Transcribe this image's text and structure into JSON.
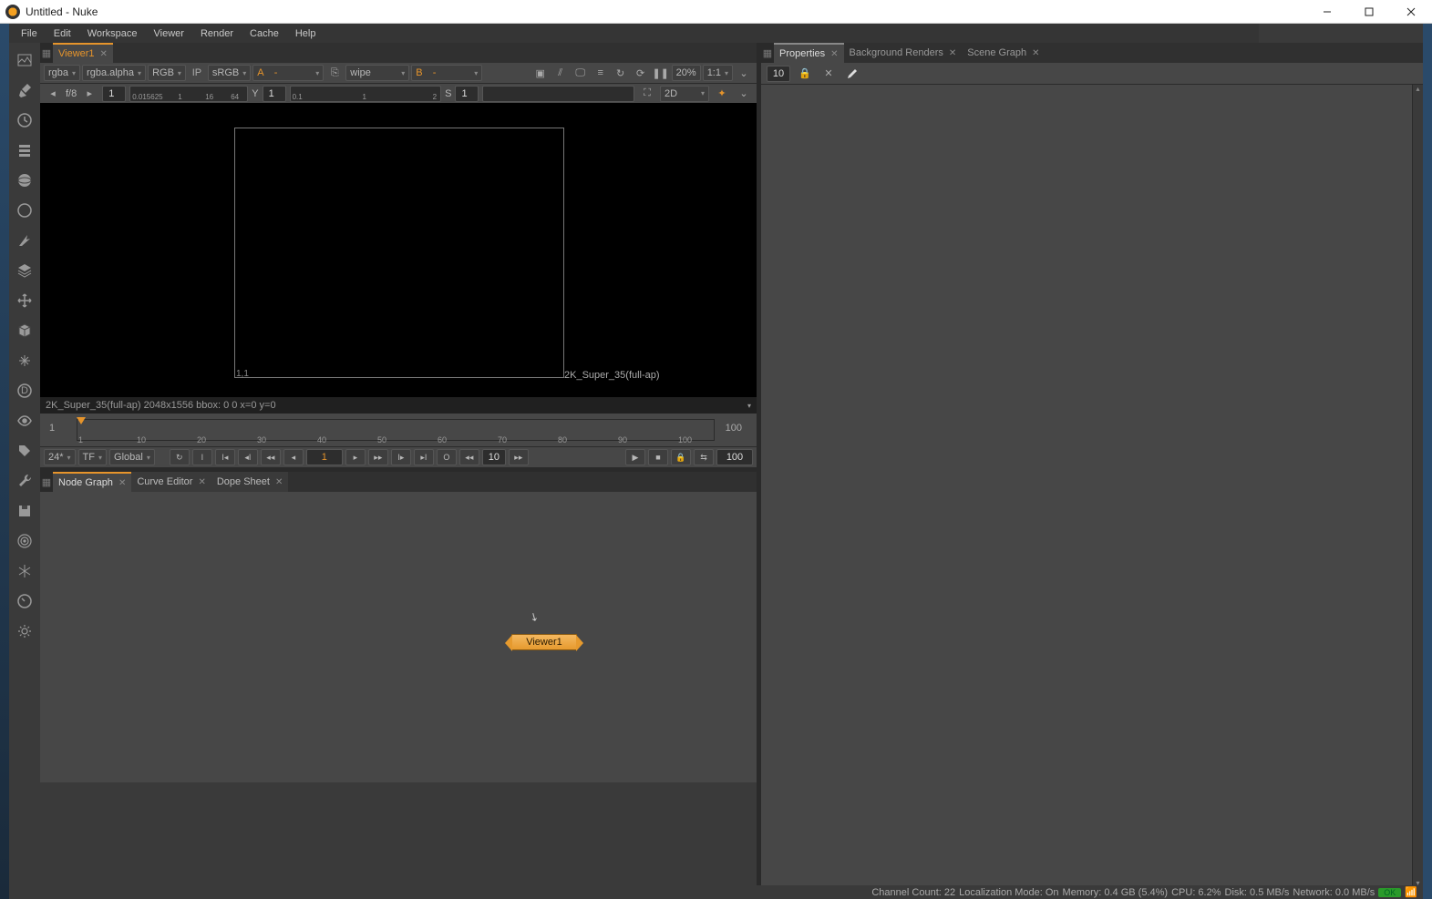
{
  "title": "Untitled - Nuke",
  "menu": [
    "File",
    "Edit",
    "Workspace",
    "Viewer",
    "Render",
    "Cache",
    "Help"
  ],
  "left_tools": [
    "image-icon",
    "pen-icon",
    "clock-icon",
    "stack-icon",
    "sphere-icon",
    "circle-icon",
    "vectors-icon",
    "layers-icon",
    "move-icon",
    "cube-icon",
    "particles-icon",
    "id-icon",
    "eye-icon",
    "tag-icon",
    "wrench-icon",
    "save-icon",
    "target-icon",
    "snow-icon",
    "gauge-icon",
    "gear-icon"
  ],
  "viewer": {
    "tab": "Viewer1",
    "channels1": "rgba",
    "channels2": "rgba.alpha",
    "display": "RGB",
    "ip_label": "IP",
    "colorspace": "sRGB",
    "a_label": "A",
    "a_value": "-",
    "wipe": "wipe",
    "b_label": "B",
    "b_value": "-",
    "zoom": "20%",
    "ratio": "1:1",
    "f_label": "f/8",
    "f_val": "1",
    "y_label": "Y",
    "y_val": "1",
    "s_label": "S",
    "s_val": "1",
    "dim_label": "2D",
    "corner": "1,1",
    "format": "2K_Super_35(full-ap)",
    "info": "2K_Super_35(full-ap) 2048x1556  bbox: 0 0   x=0 y=0",
    "ruler_labels": [
      "0.015625",
      "1",
      "16",
      "64",
      "0.1",
      "1",
      "2"
    ]
  },
  "timeline": {
    "start": "1",
    "end": "100",
    "labels": [
      "1",
      "10",
      "20",
      "30",
      "40",
      "50",
      "60",
      "70",
      "80",
      "90",
      "100"
    ]
  },
  "playback": {
    "fps": "24*",
    "tf": "TF",
    "scope": "Global",
    "current": "1",
    "skip": "10",
    "range_end": "100"
  },
  "node_graph": {
    "tabs": [
      "Node Graph",
      "Curve Editor",
      "Dope Sheet"
    ],
    "node_label": "Viewer1"
  },
  "right": {
    "tabs": [
      "Properties",
      "Background Renders",
      "Scene Graph"
    ],
    "count": "10"
  },
  "status": {
    "channel": "Channel Count: 22",
    "local": "Localization Mode: On",
    "mem": "Memory: 0.4 GB (5.4%)",
    "cpu": "CPU: 6.2%",
    "disk": "Disk: 0.5 MB/s",
    "net": "Network: 0.0 MB/s",
    "ok": "OK"
  }
}
